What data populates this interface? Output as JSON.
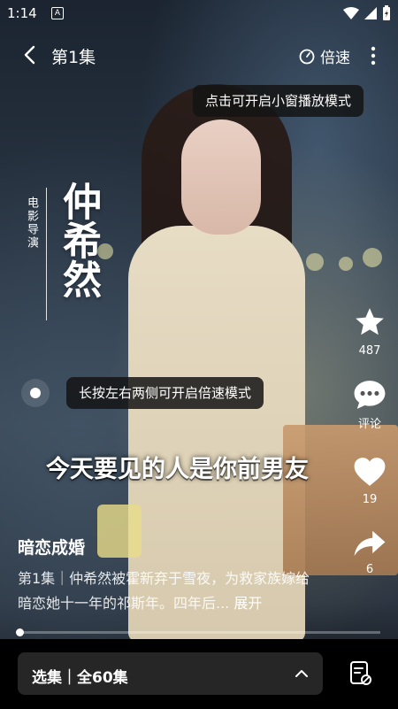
{
  "status": {
    "time": "1:14",
    "notif_icon": "a-icon"
  },
  "topbar": {
    "title": "第1集",
    "speed_label": "倍速"
  },
  "tooltips": {
    "mini_window": "点击可开启小窗播放模式",
    "speed_hold": "长按左右两侧可开启倍速模式"
  },
  "overlay": {
    "director_tag": "电影导演",
    "director_name": "仲希然"
  },
  "subtitle": "今天要见的人是你前男友",
  "side": {
    "favorite_count": "487",
    "comment_label": "评论",
    "like_count": "19",
    "share_count": "6"
  },
  "show": {
    "title": "暗恋成婚",
    "description": "第1集｜仲希然被霍新弃于雪夜，为救家族嫁给暗恋她十一年的祁斯年。四年后... ",
    "expand_label": "展开"
  },
  "playback": {
    "progress": 0.005
  },
  "bottom": {
    "episode_label": "选集｜全60集"
  },
  "colors": {
    "bottom_bar": "#000000",
    "episode_button": "#262626"
  }
}
